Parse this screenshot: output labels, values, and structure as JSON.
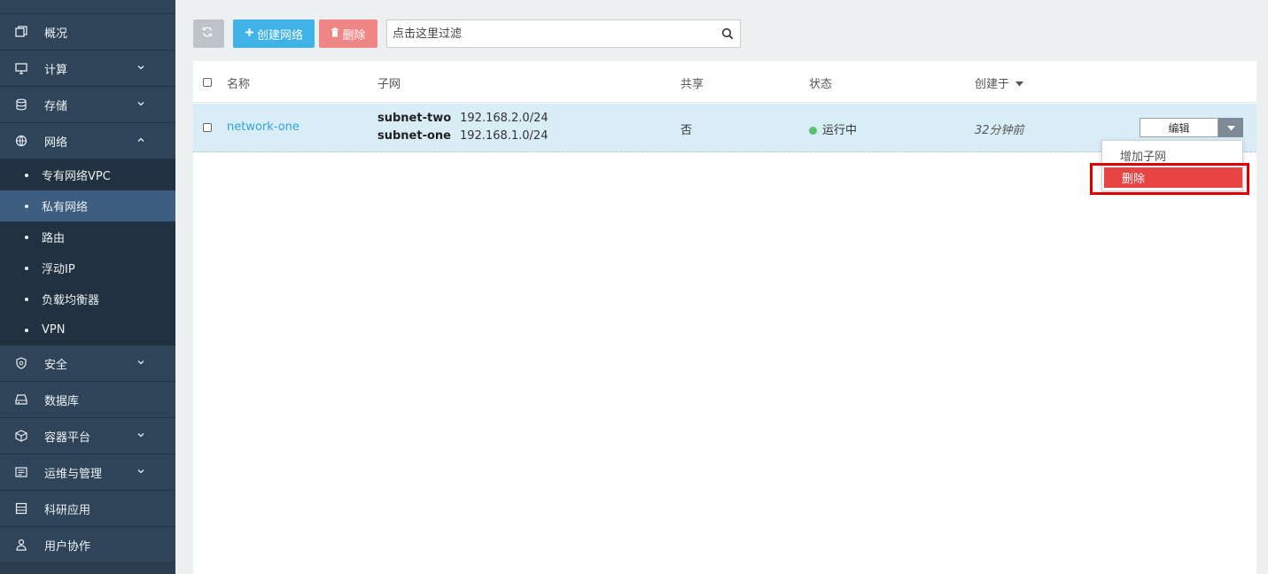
{
  "sidebar": {
    "items": [
      {
        "label": "概况",
        "icon": "overview-icon"
      },
      {
        "label": "计算",
        "icon": "monitor-icon"
      },
      {
        "label": "存储",
        "icon": "database-stack-icon"
      },
      {
        "label": "网络",
        "icon": "network-globe-icon"
      },
      {
        "label": "安全",
        "icon": "shield-icon"
      },
      {
        "label": "数据库",
        "icon": "hard-drive-icon"
      },
      {
        "label": "容器平台",
        "icon": "container-icon"
      },
      {
        "label": "运维与管理",
        "icon": "ops-list-icon"
      },
      {
        "label": "科研应用",
        "icon": "server-icon"
      },
      {
        "label": "用户协作",
        "icon": "users-icon"
      }
    ],
    "network_sub": [
      {
        "label": "专有网络VPC"
      },
      {
        "label": "私有网络"
      },
      {
        "label": "路由"
      },
      {
        "label": "浮动IP"
      },
      {
        "label": "负载均衡器"
      },
      {
        "label": "VPN"
      }
    ],
    "active_sub": "私有网络"
  },
  "toolbar": {
    "create_label": "创建网络",
    "delete_label": "删除",
    "search_placeholder": "点击这里过滤"
  },
  "table": {
    "headers": {
      "name": "名称",
      "subnet": "子网",
      "shared": "共享",
      "status": "状态",
      "created": "创建于"
    },
    "rows": [
      {
        "name": "network-one",
        "subnets": [
          {
            "name": "subnet-two",
            "cidr": "192.168.2.0/24"
          },
          {
            "name": "subnet-one",
            "cidr": "192.168.1.0/24"
          }
        ],
        "shared": "否",
        "status": "运行中",
        "created": "32分钟前",
        "action_label": "编辑"
      }
    ]
  },
  "dropdown": {
    "items": [
      {
        "label": "增加子网"
      },
      {
        "label": "删除"
      }
    ]
  },
  "colors": {
    "sidebar_bg": "#2b3e50",
    "active_sub": "#3d5e80",
    "create_btn": "#3fb2e8",
    "delete_btn": "#ef8585",
    "row_selected": "#d9edf7",
    "status_running": "#5cc16a",
    "danger": "#e84444"
  }
}
